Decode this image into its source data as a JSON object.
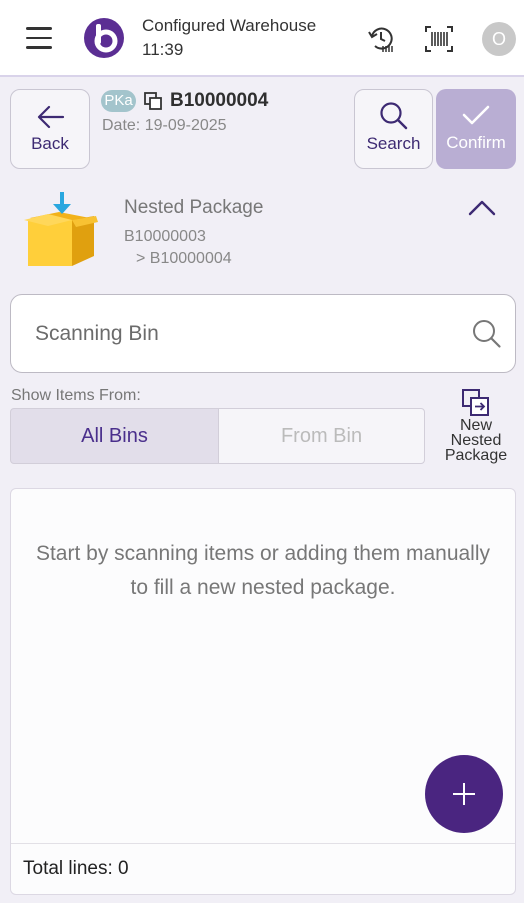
{
  "header": {
    "warehouse": "Configured Warehouse",
    "time": "11:39",
    "avatar_initial": "O"
  },
  "toolbar": {
    "back_label": "Back",
    "search_label": "Search",
    "confirm_label": "Confirm"
  },
  "document": {
    "type_badge": "PKa",
    "number": "B10000004",
    "date": "Date: 19-09-2025"
  },
  "nested_package": {
    "title": "Nested Package",
    "parent": "B10000003",
    "child": "> B10000004"
  },
  "scan": {
    "placeholder": "Scanning Bin",
    "value": ""
  },
  "filter": {
    "label": "Show Items From:",
    "options": [
      "All Bins",
      "From Bin"
    ],
    "selected": "All Bins"
  },
  "new_nested_package_label": "New\nNested\nPackage",
  "list": {
    "empty_message": "Start by scanning items or adding them manually to fill a new nested package.",
    "total_lines": "Total lines: 0"
  },
  "colors": {
    "primary": "#4a2580",
    "confirm_disabled": "#b9aed3",
    "badge": "#a3c4cc",
    "selected_segment": "#e2deea"
  },
  "icons": [
    "menu-icon",
    "app-logo-icon",
    "history-icon",
    "barcode-icon",
    "back-arrow-icon",
    "search-icon",
    "check-icon",
    "copy-icon",
    "package-box-icon",
    "chevron-up-icon",
    "nested-package-icon",
    "plus-icon"
  ]
}
